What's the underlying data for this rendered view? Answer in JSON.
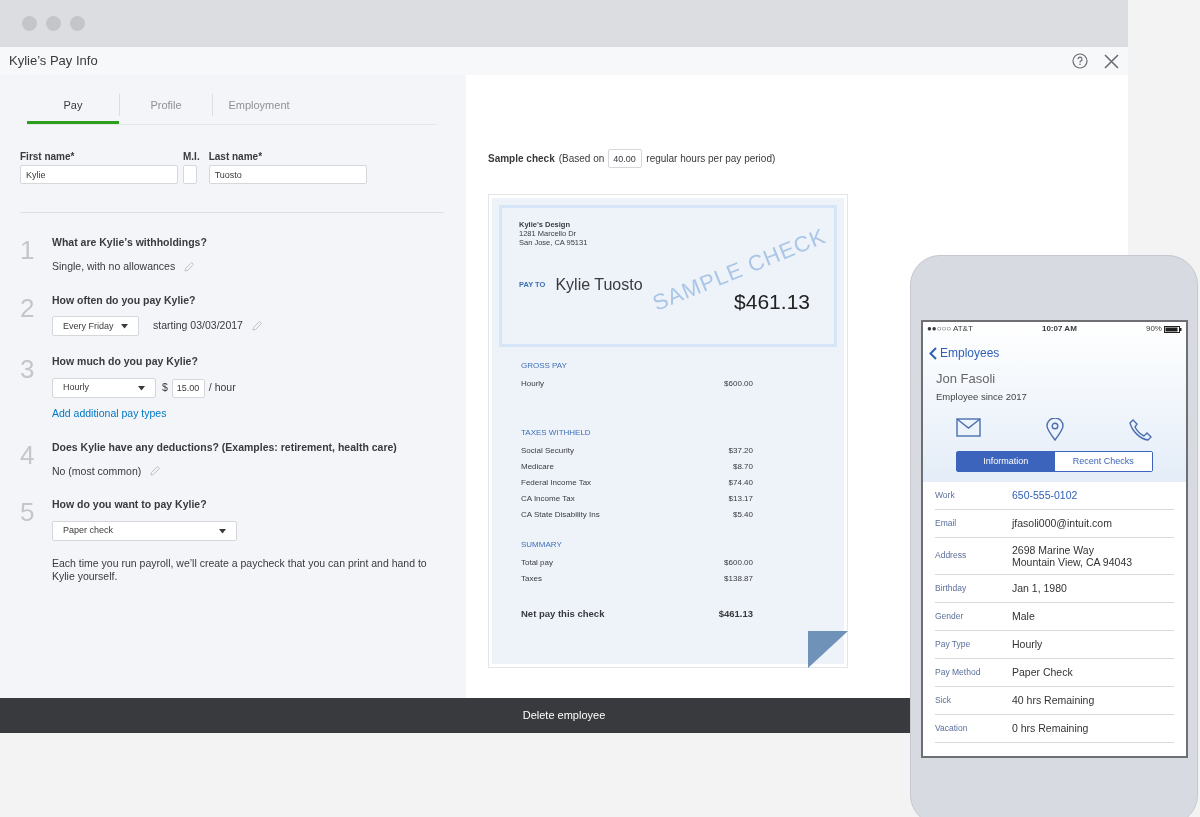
{
  "window": {
    "title": "Kylie’s Pay Info"
  },
  "tabs": [
    {
      "label": "Pay",
      "selected": true
    },
    {
      "label": "Profile",
      "selected": false
    },
    {
      "label": "Employment",
      "selected": false
    }
  ],
  "name_fields": [
    {
      "label": "First name*",
      "value": "Kylie",
      "kind": "wide"
    },
    {
      "label": "M.I.",
      "kind": "narrow"
    },
    {
      "label": "Last name*",
      "value": "Tuosto",
      "kind": "wide"
    }
  ],
  "steps": [
    {
      "number": "1",
      "question": "What are Kylie’s withholdings?",
      "summary": "Single, with no allowances"
    },
    {
      "number": "2",
      "question": "How often do you pay Kylie?",
      "select": "Every Friday",
      "summary": "starting 03/03/2017"
    },
    {
      "number": "3",
      "question": "How much do you pay Kylie?",
      "select": "Hourly",
      "rate": {
        "currency": "$",
        "value": "15.00",
        "unit": "/ hour"
      },
      "link": "Add additional pay types"
    },
    {
      "number": "4",
      "question": "Does Kylie have any deductions? (Examples: retirement, health care)",
      "summary": "No (most common)"
    },
    {
      "number": "5",
      "question": "How do you want to pay Kylie?",
      "select": "Paper check",
      "note": "Each time you run payroll, we’ll create a paycheck that you can print and hand to Kylie yourself."
    }
  ],
  "sample_check": {
    "label": "Sample check",
    "prefix": "(Based on",
    "hours": "40.00",
    "suffix": "regular hours per pay period)",
    "company": [
      "Kylie's Design",
      "1281 Marcello Dr",
      "San Jose, CA 95131"
    ],
    "pay_to_label": "PAY TO",
    "payee": "Kylie Tuosto",
    "amount": "$461.13",
    "watermark": "SAMPLE CHECK",
    "sections": [
      {
        "title": "GROSS PAY",
        "rows": [
          {
            "label": "Hourly",
            "amount": "$600.00"
          }
        ]
      },
      {
        "title": "TAXES WITHHELD",
        "rows": [
          {
            "label": "Social Security",
            "amount": "$37.20"
          },
          {
            "label": "Medicare",
            "amount": "$8.70"
          },
          {
            "label": "Federal Income Tax",
            "amount": "$74.40"
          },
          {
            "label": "CA Income Tax",
            "amount": "$13.17"
          },
          {
            "label": "CA State Disability Ins",
            "amount": "$5.40"
          }
        ]
      },
      {
        "title": "SUMMARY",
        "rows": [
          {
            "label": "Total pay",
            "amount": "$600.00"
          },
          {
            "label": "Taxes",
            "amount": "$138.87"
          }
        ]
      }
    ],
    "net": {
      "label": "Net pay this check",
      "amount": "$461.13"
    }
  },
  "footer_button": "Delete employee",
  "phone": {
    "status": {
      "carrier": "●●○○○ AT&T",
      "time": "10:07 AM",
      "battery": "90%"
    },
    "back": "Employees",
    "name": "Jon Fasoli",
    "since": "Employee since 2017",
    "segments": [
      {
        "label": "Information",
        "selected": true
      },
      {
        "label": "Recent Checks",
        "selected": false
      }
    ],
    "rows": [
      {
        "label": "Work",
        "lines": [
          "650-555-0102"
        ],
        "kind": "link"
      },
      {
        "label": "Email",
        "lines": [
          "jfasoli000@intuit.com"
        ],
        "kind": "text"
      },
      {
        "label": "Address",
        "lines": [
          "2698 Marine Way",
          "Mountain View, CA 94043"
        ],
        "kind": "text"
      },
      {
        "label": "Birthday",
        "lines": [
          "Jan 1, 1980"
        ],
        "kind": "text"
      },
      {
        "label": "Gender",
        "lines": [
          "Male"
        ],
        "kind": "text"
      },
      {
        "label": "Pay Type",
        "lines": [
          "Hourly"
        ],
        "kind": "text"
      },
      {
        "label": "Pay Method",
        "lines": [
          "Paper Check"
        ],
        "kind": "text"
      },
      {
        "label": "Sick",
        "lines": [
          "40 hrs Remaining"
        ],
        "kind": "text"
      },
      {
        "label": "Vacation",
        "lines": [
          "0 hrs Remaining"
        ],
        "kind": "text"
      }
    ]
  }
}
